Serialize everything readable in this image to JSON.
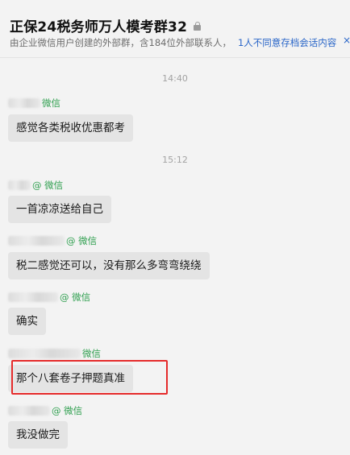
{
  "header": {
    "title": "正保24税务师万人模考群32",
    "subtitle": "由企业微信用户创建的外部群，含184位外部联系人，",
    "subtitle_link": "1人不同意存档会话内容",
    "close_glyph": "×"
  },
  "chat": {
    "timestamps": [
      "14:40",
      "15:12"
    ],
    "messages": [
      {
        "badge": "微信",
        "text": "感觉各类税收优惠都考"
      },
      {
        "badge": "@ 微信",
        "text": "一首凉凉送给自己"
      },
      {
        "badge": "@ 微信",
        "text": "税二感觉还可以，没有那么多弯弯绕绕"
      },
      {
        "badge": "@ 微信",
        "text": "确实"
      },
      {
        "badge": "微信",
        "text": "那个八套卷子押题真准"
      },
      {
        "badge": "@ 微信",
        "text": "我没做完"
      }
    ]
  },
  "colors": {
    "accent_link": "#2a66c8",
    "wechat_badge": "#2f9f4f",
    "highlight": "#e52b2b",
    "bubble": "#e4e4e4"
  }
}
